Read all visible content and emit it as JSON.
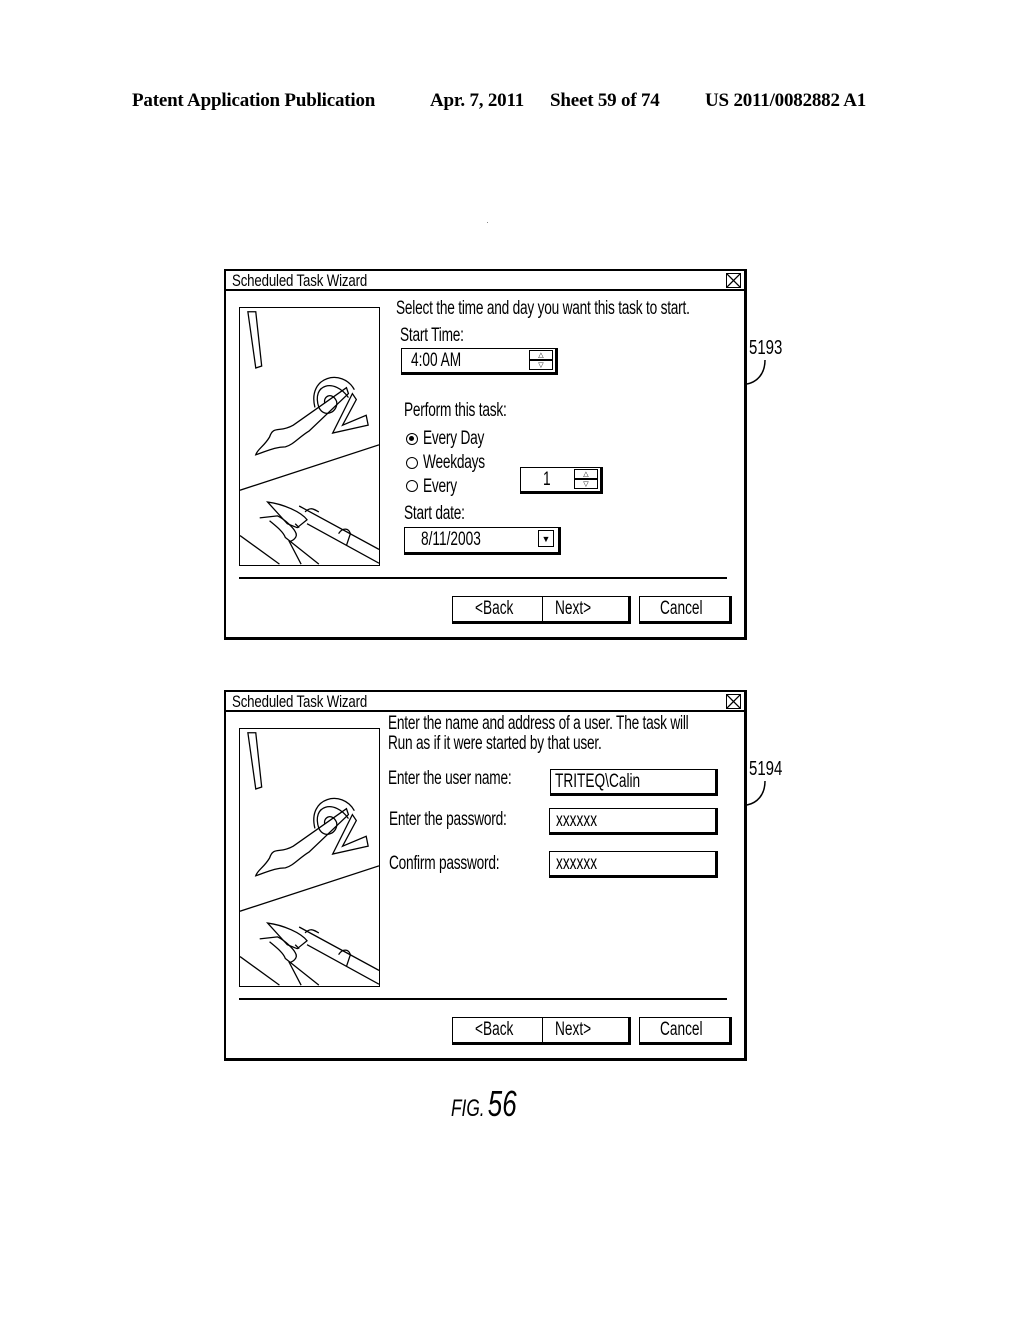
{
  "header": {
    "publication": "Patent Application Publication",
    "date": "Apr. 7, 2011",
    "sheet": "Sheet 59 of 74",
    "number": "US 2011/0082882 A1"
  },
  "dialogs": [
    {
      "callout": "5193",
      "title": "Scheduled Task Wizard",
      "close_icon": "close-x-icon",
      "instruction": "Select the time and day you want this task to start.",
      "start_time_label": "Start Time:",
      "start_time_value": "4:00 AM",
      "perform_label": "Perform this task:",
      "options": [
        {
          "label": "Every Day",
          "selected": true
        },
        {
          "label": "Weekdays",
          "selected": false
        },
        {
          "label": "Every",
          "selected": false
        }
      ],
      "every_value": "1",
      "start_date_label": "Start date:",
      "start_date_value": "8/11/2003",
      "buttons": {
        "back": "<Back",
        "next": "Next>",
        "cancel": "Cancel"
      }
    },
    {
      "callout": "5194",
      "title": "Scheduled Task Wizard",
      "close_icon": "close-x-icon",
      "instruction_line1": "Enter the name and address of a user. The task will",
      "instruction_line2": "Run as if it were started by that user.",
      "username_label": "Enter the user name:",
      "username_value": "TRITEQ\\Calin",
      "password_label": "Enter the password:",
      "password_value": "xxxxxx",
      "confirm_label": "Confirm password:",
      "confirm_value": "xxxxxx",
      "buttons": {
        "back": "<Back",
        "next": "Next>",
        "cancel": "Cancel"
      }
    }
  ],
  "figure": {
    "prefix": "FIG.",
    "number": "56"
  }
}
